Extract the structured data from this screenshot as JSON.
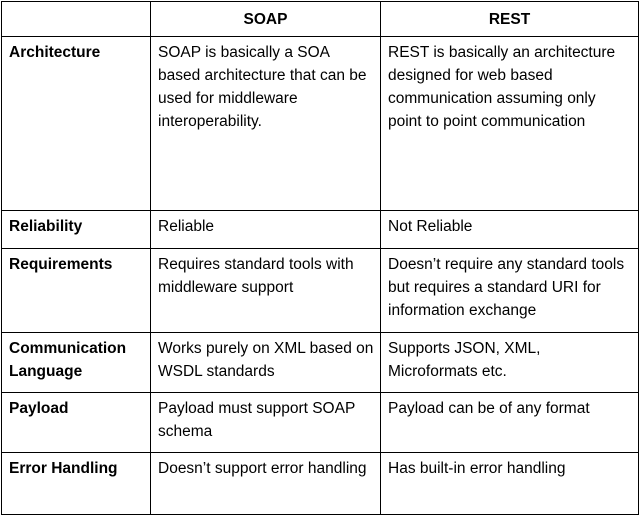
{
  "header": {
    "corner": "",
    "col_soap": "SOAP",
    "col_rest": "REST"
  },
  "rows": [
    {
      "label": "Architecture",
      "soap": "SOAP is basically a SOA based architecture that can be used for middleware interoperability.",
      "rest": "REST is basically an architecture designed for web based communication assuming only point to point communication"
    },
    {
      "label": "Reliability",
      "soap": "Reliable",
      "rest": "Not Reliable"
    },
    {
      "label": "Requirements",
      "soap": "Requires standard tools with middleware support",
      "rest": "Doesn’t require any standard tools but requires a standard URI for information exchange"
    },
    {
      "label": "Communication Language",
      "soap": "Works purely on XML based on WSDL standards",
      "rest": "Supports JSON, XML, Microformats etc."
    },
    {
      "label": "Payload",
      "soap": "Payload must support SOAP schema",
      "rest": "Payload can be of any format"
    },
    {
      "label": "Error Handling",
      "soap": "Doesn’t support error handling",
      "rest": "Has built-in error handling"
    }
  ]
}
